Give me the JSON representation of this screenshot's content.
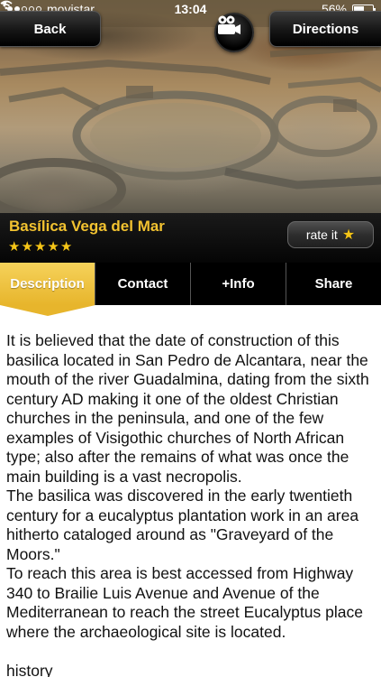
{
  "status_bar": {
    "carrier": "movistar",
    "time": "13:04",
    "battery": "56%",
    "battery_level": 0.56
  },
  "nav": {
    "back_label": "Back",
    "directions_label": "Directions",
    "video_icon": "video-camera-icon"
  },
  "place": {
    "title": "Basílica Vega del Mar",
    "rating": 5,
    "rating_max": 5,
    "rate_label": "rate it"
  },
  "tabs": [
    {
      "label": "Description",
      "active": true
    },
    {
      "label": "Contact",
      "active": false
    },
    {
      "label": "+Info",
      "active": false
    },
    {
      "label": "Share",
      "active": false
    }
  ],
  "colors": {
    "accent": "#e7b52c",
    "title": "#f2c230",
    "star": "#f5c518"
  },
  "description": {
    "paragraphs": [
      "It is believed that the date of construction of this basilica located in San Pedro de Alcantara, near the mouth of the river Guadalmina, dating from the sixth century AD making it one of the oldest Christian churches in the peninsula, and one of the few examples of Visigothic churches of North African type; also after the remains of what was once the main building is a vast necropolis.",
      "The basilica was discovered in the early twentieth century for a eucalyptus plantation work in an area hitherto cataloged around as \"Graveyard of the Moors.\"",
      "To reach this area is best accessed from Highway 340 to Brailie Luis Avenue and Avenue of the Mediterranean to reach the street Eucalyptus place where the archaeological site is located."
    ],
    "section_label": "history"
  }
}
